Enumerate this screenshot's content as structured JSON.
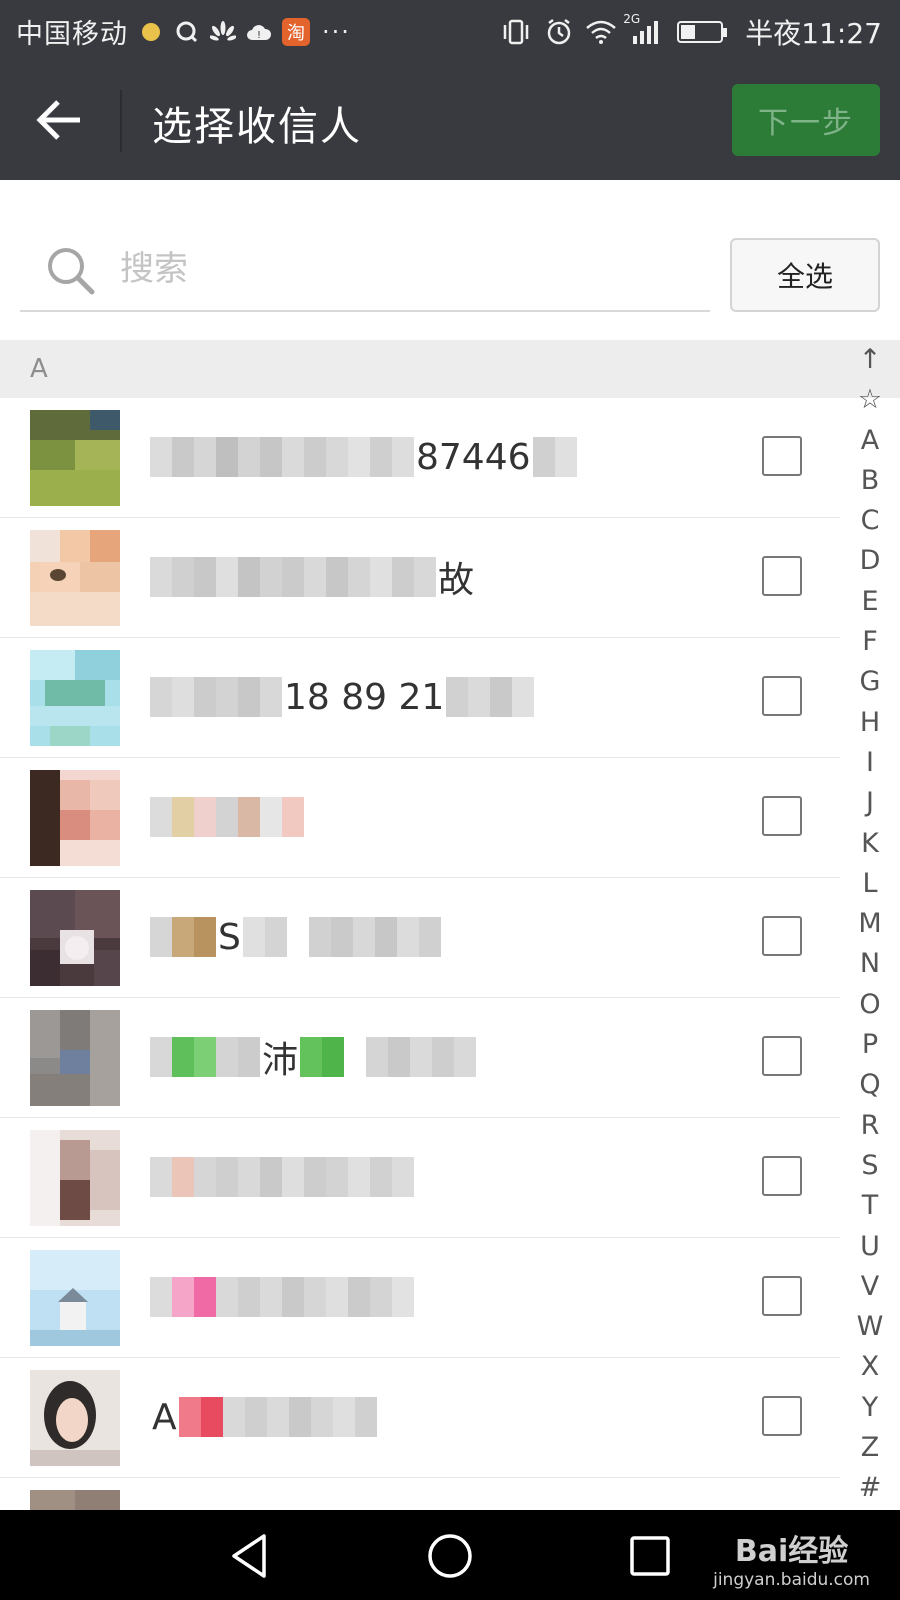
{
  "status_bar": {
    "carrier": "中国移动",
    "taobao_label": "淘",
    "more": "···",
    "network": "2G",
    "time": "半夜11:27",
    "icons_left": [
      "dot-icon",
      "qq-icon",
      "huawei-icon",
      "cloud-icon",
      "taobao-icon"
    ],
    "icons_right": [
      "vibrate-icon",
      "alarm-icon",
      "wifi-icon",
      "signal-icon",
      "battery-icon"
    ]
  },
  "header": {
    "title": "选择收信人",
    "next_label": "下一步",
    "colors": {
      "bar": "#393a3f",
      "next_bg": "#2c7b37",
      "next_text": "#7fb388"
    }
  },
  "search": {
    "placeholder": "搜索",
    "select_all_label": "全选"
  },
  "section": {
    "letter": "A"
  },
  "contacts": [
    {
      "name_visible": "87446",
      "checked": false
    },
    {
      "name_visible": "故",
      "checked": false
    },
    {
      "name_visible": "18 89 21",
      "checked": false
    },
    {
      "name_visible": "",
      "checked": false
    },
    {
      "name_visible": "S",
      "checked": false
    },
    {
      "name_visible": "沛",
      "checked": false
    },
    {
      "name_visible": "",
      "checked": false
    },
    {
      "name_visible": "",
      "checked": false
    },
    {
      "name_visible": "A",
      "checked": false
    }
  ],
  "index_bar": [
    "↑",
    "☆",
    "A",
    "B",
    "C",
    "D",
    "E",
    "F",
    "G",
    "H",
    "I",
    "J",
    "K",
    "L",
    "M",
    "N",
    "O",
    "P",
    "Q",
    "R",
    "S",
    "T",
    "U",
    "V",
    "W",
    "X",
    "Y",
    "Z",
    "#"
  ],
  "nav": {
    "buttons": [
      "back-triangle-icon",
      "home-circle-icon",
      "recents-square-icon"
    ]
  },
  "watermark": {
    "brand": "Bai经验",
    "url": "jingyan.baidu.com"
  }
}
